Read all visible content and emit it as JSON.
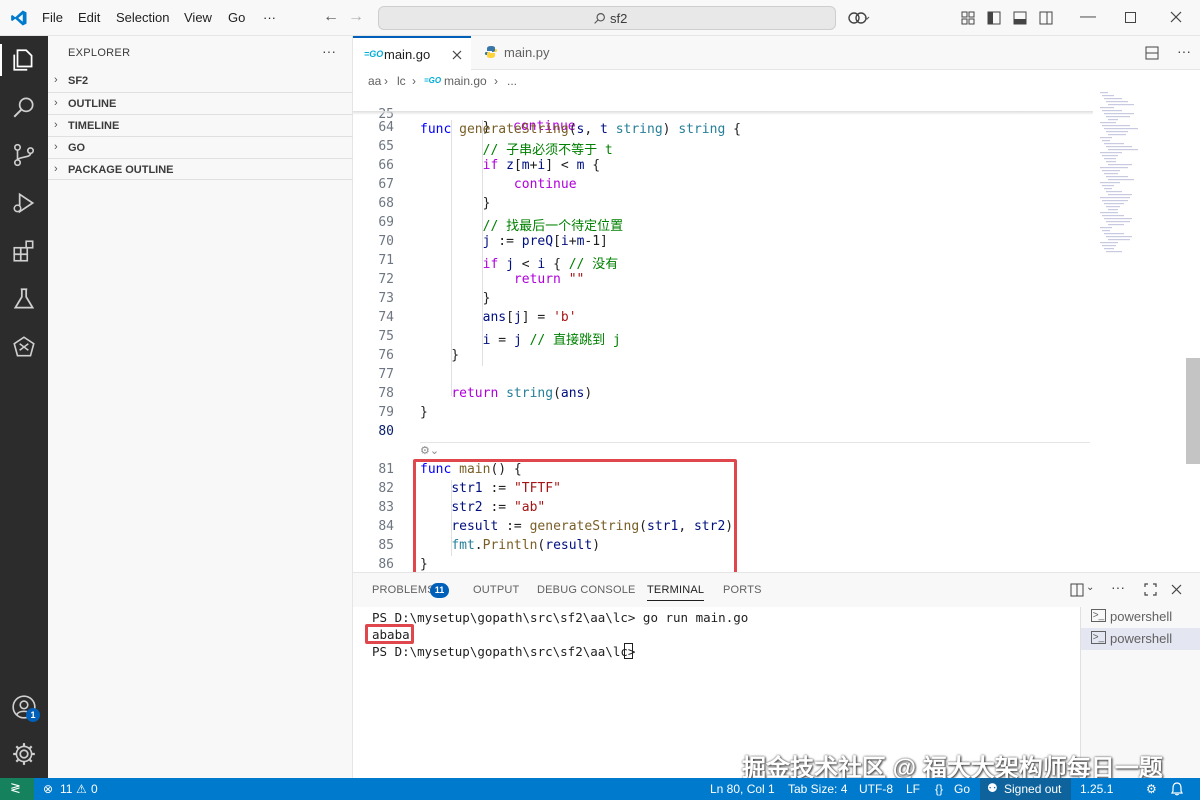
{
  "menu": {
    "file": "File",
    "edit": "Edit",
    "selection": "Selection",
    "view": "View",
    "go": "Go",
    "more": "···"
  },
  "search": {
    "text": "sf2"
  },
  "activity": {
    "accounts_badge": "1"
  },
  "sidebar": {
    "title": "EXPLORER",
    "more": "···",
    "sections": [
      "SF2",
      "OUTLINE",
      "TIMELINE",
      "GO",
      "PACKAGE OUTLINE"
    ]
  },
  "tabs": [
    {
      "label": "main.go",
      "icon": "go-file-icon",
      "active": true
    },
    {
      "label": "main.py",
      "icon": "python-file-icon",
      "active": false
    }
  ],
  "breadcrumb": [
    "aa",
    "lc",
    "main.go",
    "..."
  ],
  "editor": {
    "sticky_line": {
      "num": "25",
      "text": "func generateString(s, t string) string {"
    },
    "lines": [
      {
        "num": "64",
        "text": "        }"
      },
      {
        "num": "65",
        "text": "        // 子串必须不等于 t"
      },
      {
        "num": "66",
        "text": "        if z[m+i] < m {"
      },
      {
        "num": "67",
        "text": "            continue"
      },
      {
        "num": "68",
        "text": "        }"
      },
      {
        "num": "69",
        "text": "        // 找最后一个待定位置"
      },
      {
        "num": "70",
        "text": "        j := preQ[i+m-1]"
      },
      {
        "num": "71",
        "text": "        if j < i { // 没有"
      },
      {
        "num": "72",
        "text": "            return \"\""
      },
      {
        "num": "73",
        "text": "        }"
      },
      {
        "num": "74",
        "text": "        ans[j] = 'b'"
      },
      {
        "num": "75",
        "text": "        i = j // 直接跳到 j"
      },
      {
        "num": "76",
        "text": "    }"
      },
      {
        "num": "77",
        "text": ""
      },
      {
        "num": "78",
        "text": "    return string(ans)"
      },
      {
        "num": "79",
        "text": "}"
      },
      {
        "num": "80",
        "text": ""
      },
      {
        "num": "81",
        "text": "func main() {"
      },
      {
        "num": "82",
        "text": "    str1 := \"TFTF\""
      },
      {
        "num": "83",
        "text": "    str2 := \"ab\""
      },
      {
        "num": "84",
        "text": "    result := generateString(str1, str2)"
      },
      {
        "num": "85",
        "text": "    fmt.Println(result)"
      },
      {
        "num": "86",
        "text": "}"
      }
    ],
    "partial_line": "continue"
  },
  "panel": {
    "tabs": [
      "PROBLEMS",
      "OUTPUT",
      "DEBUG CONSOLE",
      "TERMINAL",
      "PORTS"
    ],
    "problems_count": "11",
    "terminal_lines": [
      "PS D:\\mysetup\\gopath\\src\\sf2\\aa\\lc> go run main.go",
      "ababa",
      "PS D:\\mysetup\\gopath\\src\\sf2\\aa\\lc> "
    ],
    "terminals": [
      "powershell",
      "powershell"
    ]
  },
  "statusbar": {
    "errors": "11",
    "warnings": "0",
    "position": "Ln 80, Col 1",
    "tab_size": "Tab Size: 4",
    "encoding": "UTF-8",
    "eol": "LF",
    "language": "Go",
    "account": "Signed out",
    "go_version": "1.25.1"
  },
  "watermark": "掘金技术社区 @ 福大大架构师每日一题",
  "colors": {
    "accent": "#005fb8",
    "statusbar": "#007acc",
    "highlight_box": "#e0474c"
  }
}
